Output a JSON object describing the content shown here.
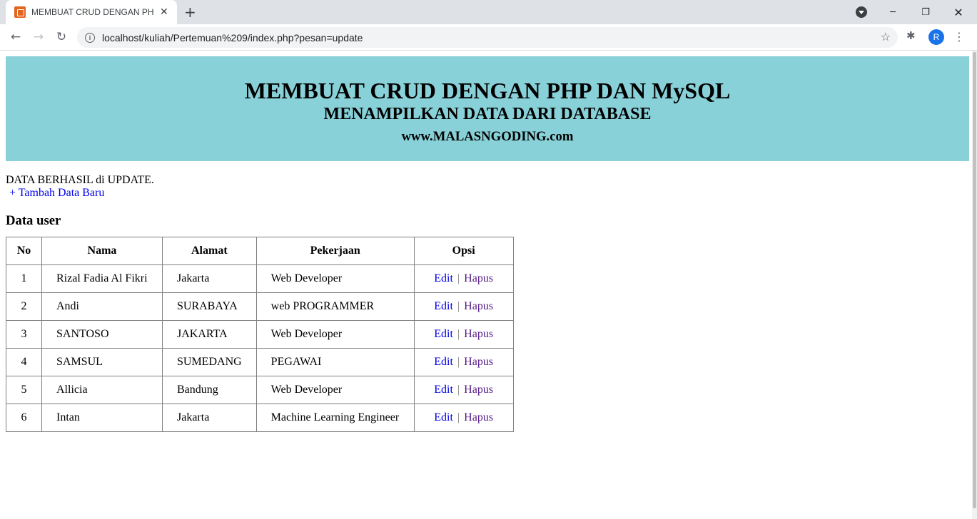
{
  "browser": {
    "tab_title": "MEMBUAT CRUD DENGAN PHP D",
    "url": "localhost/kuliah/Pertemuan%209/index.php?pesan=update",
    "profile_initial": "R"
  },
  "header": {
    "title": "MEMBUAT CRUD DENGAN PHP DAN MySQL",
    "subtitle": "MENAMPILKAN DATA DARI DATABASE",
    "site": "www.MALASNGODING.com",
    "background_color": "#88d1d8"
  },
  "message": "DATA BERHASIL di UPDATE.",
  "add_link": "+ Tambah Data Baru",
  "section_title": "Data user",
  "table": {
    "headers": [
      "No",
      "Nama",
      "Alamat",
      "Pekerjaan",
      "Opsi"
    ],
    "rows": [
      {
        "no": "1",
        "nama": "Rizal Fadia Al Fikri",
        "alamat": "Jakarta",
        "pekerjaan": "Web Developer"
      },
      {
        "no": "2",
        "nama": "Andi",
        "alamat": "SURABAYA",
        "pekerjaan": "web PROGRAMMER"
      },
      {
        "no": "3",
        "nama": "SANTOSO",
        "alamat": "JAKARTA",
        "pekerjaan": "Web Developer"
      },
      {
        "no": "4",
        "nama": "SAMSUL",
        "alamat": "SUMEDANG",
        "pekerjaan": "PEGAWAI"
      },
      {
        "no": "5",
        "nama": "Allicia",
        "alamat": "Bandung",
        "pekerjaan": "Web Developer"
      },
      {
        "no": "6",
        "nama": "Intan",
        "alamat": "Jakarta",
        "pekerjaan": "Machine Learning Engineer"
      }
    ],
    "edit_label": "Edit",
    "separator": "|",
    "delete_label": "Hapus"
  }
}
